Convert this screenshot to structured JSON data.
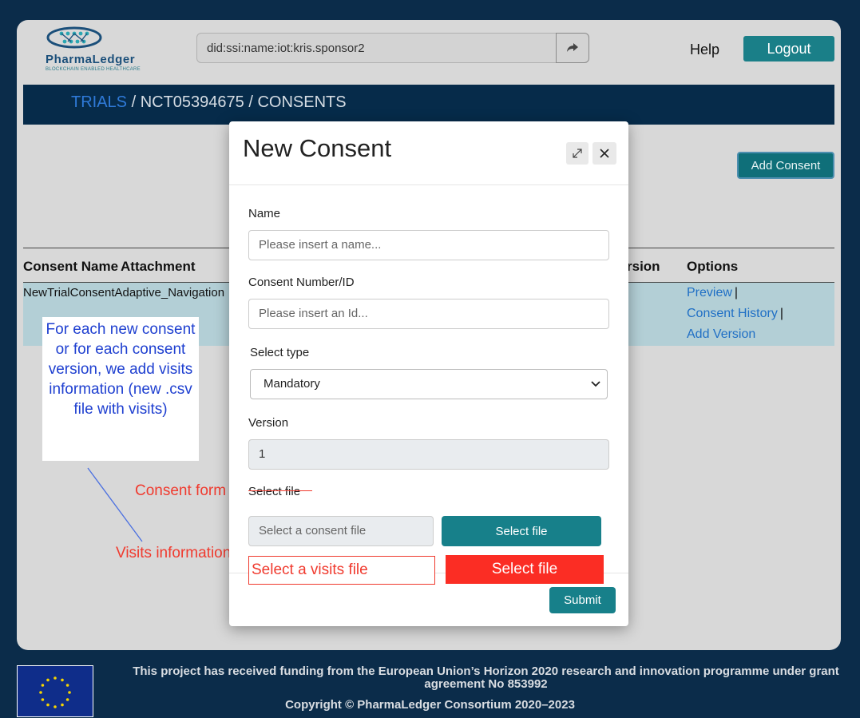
{
  "header": {
    "logo_name": "PharmaLedger",
    "logo_tagline": "BLOCKCHAIN ENABLED HEALTHCARE",
    "did_value": "did:ssi:name:iot:kris.sponsor2",
    "help_label": "Help",
    "logout_label": "Logout"
  },
  "breadcrumb": {
    "trials": "TRIALS",
    "rest": " / NCT05394675 / CONSENTS"
  },
  "page": {
    "add_consent_label": "Add Consent"
  },
  "table": {
    "headers": [
      "Consent Name",
      "Attachment",
      "rsion",
      "Options"
    ],
    "rows": [
      {
        "name": "NewTrialConsentAdaptive_Navigation",
        "options": [
          "Preview",
          "Consent History",
          "Add Version"
        ],
        "separator": "|"
      }
    ]
  },
  "modal": {
    "title": "New Consent",
    "name_label": "Name",
    "name_placeholder": "Please insert a name...",
    "id_label": "Consent Number/ID",
    "id_placeholder": "Please insert an Id...",
    "type_label": "Select type",
    "type_value": "Mandatory",
    "version_label": "Version",
    "version_value": "1",
    "file_label": "Select file",
    "consent_file_placeholder": "Select a consent file",
    "select_file_label": "Select file",
    "visits_file_placeholder": "Select a visits file",
    "visits_select_file_label": "Select file",
    "submit_label": "Submit"
  },
  "annotations": {
    "note": "For each new consent or for each consent version, we add visits information (new .csv file with visits)",
    "consent_form": "Consent form",
    "visits_information": "Visits information"
  },
  "footer": {
    "funding": "This project has received funding from the European Union’s Horizon 2020 research and innovation programme under grant agreement No 853992",
    "copyright": "Copyright © PharmaLedger Consortium 2020–2023"
  },
  "colors": {
    "background": "#0b2c4a",
    "accent": "#17808a",
    "link": "#1f6fc5",
    "annotation_red": "#f03a2e",
    "annotation_blue": "#1e3fd0"
  }
}
